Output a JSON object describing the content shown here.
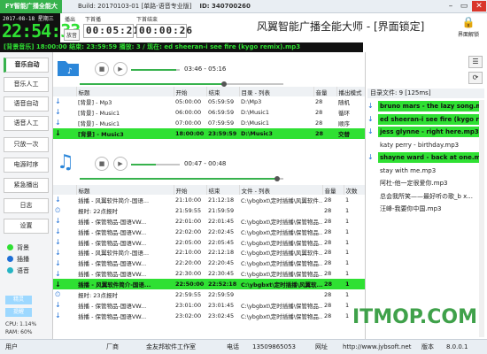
{
  "window": {
    "app_badge": "FY智能广播全能大师",
    "build": "Build: 20170103-01 [单路-语音专业版]",
    "serial": "ID: 340700260"
  },
  "clock": {
    "date": "2017-08-18  星期三",
    "time": "22:54:33"
  },
  "timers": {
    "play_label": "播出",
    "next_label": "下首播",
    "end_label": "下首结束",
    "current_label": "放音",
    "remaining": "00:05:21",
    "next": "00:00:26"
  },
  "app_title": "风翼智能广播全能大师 - [界面锁定]",
  "unlock_label": "界面解锁",
  "marquee": "[背景音乐]  18:00:00 结束: 23:59:59  播放: 3 / 现在: ed sheeran-i see fire (kygo remix).mp3",
  "sidebar": {
    "items": [
      "音乐自动",
      "音乐人工",
      "语音自动",
      "语音人工",
      "只放一次",
      "电源时序",
      "紧急播出",
      "日志",
      "设置"
    ],
    "legend": [
      {
        "label": "背景",
        "color": "#2fe033"
      },
      {
        "label": "插播",
        "color": "#1e6fd6"
      },
      {
        "label": "语音",
        "color": "#26b5c4"
      }
    ],
    "btn1": "精灵",
    "btn2": "提醒",
    "cpu": "CPU: 1.14%",
    "ram": "RAM: 60%"
  },
  "music_player": {
    "elapsed": "03:46",
    "total": "05:16",
    "progress": 0.71,
    "volume": 0.92
  },
  "music_table": {
    "headers": [
      "",
      "标题",
      "开始",
      "结束",
      "目录 - 列表",
      "音量",
      "播出模式"
    ],
    "rows": [
      [
        "↓",
        "[背景] - Mp3",
        "05:00:00",
        "05:59:59",
        "D:\\Mp3",
        "28",
        "随机"
      ],
      [
        "↓",
        "[背景] - Music1",
        "06:00:00",
        "06:59:59",
        "D:\\Music1",
        "28",
        "循环"
      ],
      [
        "↓",
        "[背景] - Music1",
        "07:00:00",
        "07:59:59",
        "D:\\Music1",
        "28",
        "顺序"
      ],
      [
        "↓",
        "[背景] - Music3",
        "18:00:00",
        "23:59:59",
        "D:\\Music3",
        "28",
        "交替"
      ]
    ],
    "highlight_row": 3
  },
  "voice_player": {
    "elapsed": "00:47",
    "total": "00:48",
    "progress": 0.97,
    "volume": 0.5
  },
  "voice_table": {
    "headers": [
      "",
      "标题",
      "开始",
      "结束",
      "文件 - 列表",
      "音量",
      "次数"
    ],
    "rows": [
      [
        "↓",
        "插播 - 风翼软件简介-国语...",
        "21:10:00",
        "21:12:18",
        "C:\\ybgbxt\\定时插播\\风翼软件...",
        "28",
        "1"
      ],
      [
        "⏲",
        "报时: 22点报时",
        "21:59:55",
        "21:59:59",
        "",
        "28",
        "1"
      ],
      [
        "↓",
        "插播 - 保管物品-国语VW...",
        "22:01:00",
        "22:01:45",
        "C:\\ybgbxt\\定时插播\\保管物品...",
        "28",
        "1"
      ],
      [
        "↓",
        "插播 - 保管物品-国语VW...",
        "22:02:00",
        "22:02:45",
        "C:\\ybgbxt\\定时插播\\保管物品...",
        "28",
        "1"
      ],
      [
        "↓",
        "插播 - 保管物品-国语VW...",
        "22:05:00",
        "22:05:45",
        "C:\\ybgbxt\\定时插播\\保管物品...",
        "28",
        "1"
      ],
      [
        "↓",
        "插播 - 风翼软件简介-国语...",
        "22:10:00",
        "22:12:18",
        "C:\\ybgbxt\\定时插播\\风翼软件...",
        "28",
        "1"
      ],
      [
        "↓",
        "插播 - 保管物品-国语VW...",
        "22:20:00",
        "22:20:45",
        "C:\\ybgbxt\\定时插播\\保管物品...",
        "28",
        "1"
      ],
      [
        "↓",
        "插播 - 保管物品-国语VW...",
        "22:30:00",
        "22:30:45",
        "C:\\ybgbxt\\定时插播\\保管物品...",
        "28",
        "1"
      ],
      [
        "↓",
        "插播 - 风翼软件简介-国语...",
        "22:50:00",
        "22:52:18",
        "C:\\ybgbxt\\定时插播\\风翼软...",
        "28",
        "1"
      ],
      [
        "⏲",
        "报时: 23点报时",
        "22:59:55",
        "22:59:59",
        "",
        "28",
        "1"
      ],
      [
        "↓",
        "插播 - 保管物品-国语VW...",
        "23:01:00",
        "23:01:45",
        "C:\\ybgbxt\\定时插播\\保管物品...",
        "28",
        "1"
      ],
      [
        "↓",
        "插播 - 保管物品-国语VW...",
        "23:02:00",
        "23:02:45",
        "C:\\ybgbxt\\定时插播\\保管物品...",
        "28",
        "1"
      ]
    ],
    "highlight_row": 8
  },
  "right_panel": {
    "header": "目录文件: 9  [125ms]",
    "items": [
      {
        "name": "bruno mars - the lazy song.m...",
        "hl": true,
        "check": true
      },
      {
        "name": "ed sheeran-i see fire (kygo re...",
        "hl": true,
        "check": true
      },
      {
        "name": "jess glynne - right here.mp3",
        "hl": true,
        "check": true
      },
      {
        "name": "katy perry - birthday.mp3",
        "hl": false,
        "check": false
      },
      {
        "name": "shayne ward - back at one.mp3",
        "hl": true,
        "check": true
      },
      {
        "name": "stay with me.mp3",
        "hl": false,
        "check": false
      },
      {
        "name": "阿杜-他一定很爱你.mp3",
        "hl": false,
        "check": false
      },
      {
        "name": "总会我所笑——最好听の歌_b x...",
        "hl": false,
        "check": false
      },
      {
        "name": "汪峰-我要你中国.mp3",
        "hl": false,
        "check": false
      }
    ]
  },
  "statusbar": {
    "user": "用户",
    "vendor_label": "厂商",
    "vendor": "金友邦软件工作室",
    "phone_label": "电话",
    "phone": "13509865053",
    "site_label": "网址",
    "site": "http://www.jybsoft.net",
    "version_label": "版本",
    "version": "8.0.0.1"
  },
  "watermark": "ITMOP.COM"
}
